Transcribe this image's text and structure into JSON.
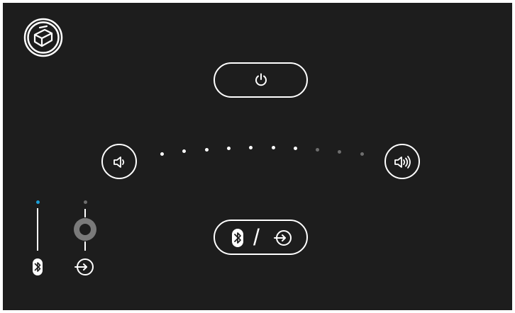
{
  "device": {
    "logo_icon": "box-logo-icon"
  },
  "controls": {
    "power": {
      "icon": "power-icon",
      "label": ""
    },
    "volume_down": {
      "icon": "speaker-low-icon"
    },
    "volume_up": {
      "icon": "speaker-high-icon"
    },
    "volume": {
      "level": 7,
      "max": 10
    },
    "source_toggle": {
      "left_icon": "bluetooth-icon",
      "separator": "/",
      "right_icon": "input-icon"
    }
  },
  "indicators": {
    "bluetooth": {
      "icon": "bluetooth-icon",
      "active": true,
      "led_color": "#1a9fd8"
    },
    "aux_input": {
      "icon": "input-icon",
      "active": false,
      "led_color": "#6e6e6e",
      "knob_icon": "aux-knob-icon"
    }
  },
  "colors": {
    "background": "#1d1d1d",
    "foreground": "#ffffff",
    "inactive": "#6e6e6e",
    "accent": "#1a9fd8"
  }
}
